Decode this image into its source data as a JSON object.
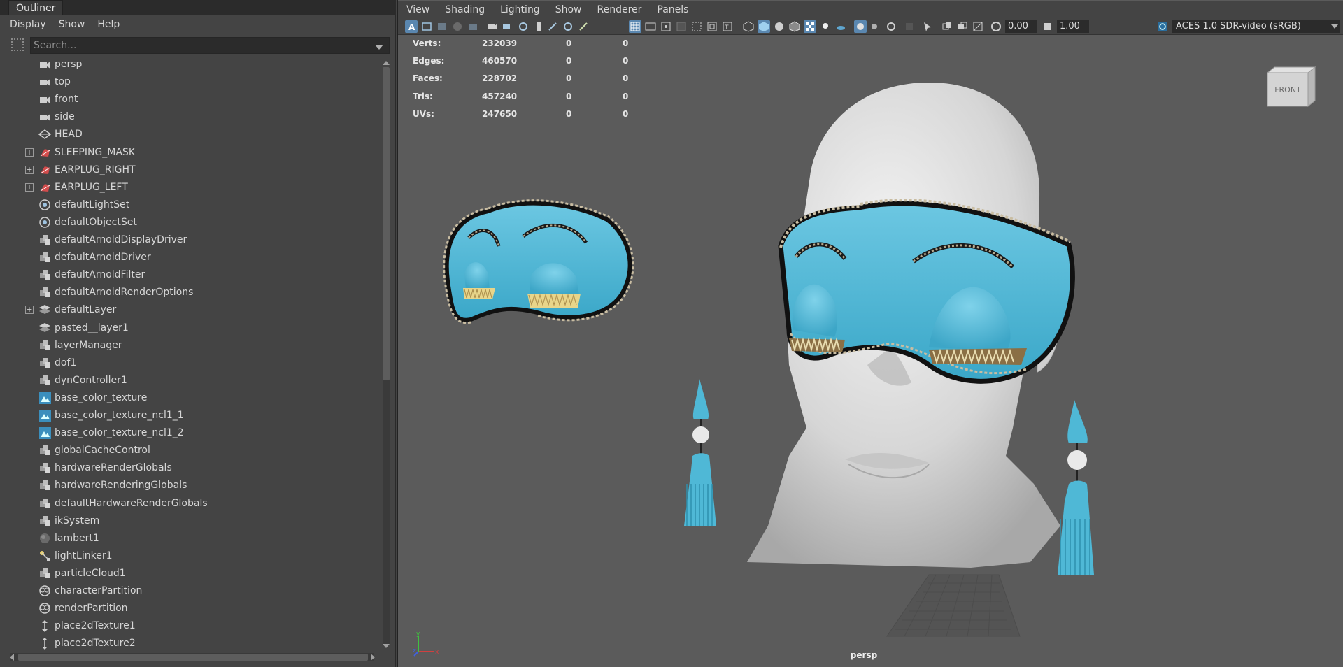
{
  "outliner": {
    "tab": "Outliner",
    "menu": [
      "Display",
      "Show",
      "Help"
    ],
    "search_placeholder": "Search...",
    "items": [
      {
        "label": "persp",
        "icon": "camera-icon",
        "expandable": false
      },
      {
        "label": "top",
        "icon": "camera-icon",
        "expandable": false
      },
      {
        "label": "front",
        "icon": "camera-icon",
        "expandable": false
      },
      {
        "label": "side",
        "icon": "camera-icon",
        "expandable": false
      },
      {
        "label": "HEAD",
        "icon": "mesh-icon",
        "expandable": false
      },
      {
        "label": "SLEEPING_MASK",
        "icon": "mesh-group-icon",
        "expandable": true
      },
      {
        "label": "EARPLUG_RIGHT",
        "icon": "mesh-group-icon",
        "expandable": true
      },
      {
        "label": "EARPLUG_LEFT",
        "icon": "mesh-group-icon",
        "expandable": true
      },
      {
        "label": "defaultLightSet",
        "icon": "set-icon",
        "expandable": false
      },
      {
        "label": "defaultObjectSet",
        "icon": "set-icon",
        "expandable": false
      },
      {
        "label": "defaultArnoldDisplayDriver",
        "icon": "node-icon",
        "expandable": false
      },
      {
        "label": "defaultArnoldDriver",
        "icon": "node-icon",
        "expandable": false
      },
      {
        "label": "defaultArnoldFilter",
        "icon": "node-icon",
        "expandable": false
      },
      {
        "label": "defaultArnoldRenderOptions",
        "icon": "node-icon",
        "expandable": false
      },
      {
        "label": "defaultLayer",
        "icon": "layer-icon",
        "expandable": true
      },
      {
        "label": "pasted__layer1",
        "icon": "layer-icon",
        "expandable": false
      },
      {
        "label": "layerManager",
        "icon": "node-icon",
        "expandable": false
      },
      {
        "label": "dof1",
        "icon": "node-icon",
        "expandable": false
      },
      {
        "label": "dynController1",
        "icon": "node-icon",
        "expandable": false
      },
      {
        "label": "base_color_texture",
        "icon": "texture-icon",
        "expandable": false
      },
      {
        "label": "base_color_texture_ncl1_1",
        "icon": "texture-icon",
        "expandable": false
      },
      {
        "label": "base_color_texture_ncl1_2",
        "icon": "texture-icon",
        "expandable": false
      },
      {
        "label": "globalCacheControl",
        "icon": "node-icon",
        "expandable": false
      },
      {
        "label": "hardwareRenderGlobals",
        "icon": "node-icon",
        "expandable": false
      },
      {
        "label": "hardwareRenderingGlobals",
        "icon": "node-icon",
        "expandable": false
      },
      {
        "label": "defaultHardwareRenderGlobals",
        "icon": "node-icon",
        "expandable": false
      },
      {
        "label": "ikSystem",
        "icon": "node-icon",
        "expandable": false
      },
      {
        "label": "lambert1",
        "icon": "material-sphere-icon",
        "expandable": false
      },
      {
        "label": "lightLinker1",
        "icon": "light-linker-icon",
        "expandable": false
      },
      {
        "label": "particleCloud1",
        "icon": "node-icon",
        "expandable": false
      },
      {
        "label": "characterPartition",
        "icon": "partition-icon",
        "expandable": false
      },
      {
        "label": "renderPartition",
        "icon": "partition-icon",
        "expandable": false
      },
      {
        "label": "place2dTexture1",
        "icon": "place2d-icon",
        "expandable": false
      },
      {
        "label": "place2dTexture2",
        "icon": "place2d-icon",
        "expandable": false
      }
    ]
  },
  "viewport": {
    "menu": [
      "View",
      "Shading",
      "Lighting",
      "Show",
      "Renderer",
      "Panels"
    ],
    "exposure": "0.00",
    "gamma": "1.00",
    "color_space": "ACES 1.0 SDR-video (sRGB)",
    "camera": "persp",
    "view_cube_label": "FRONT",
    "stats": [
      {
        "label": "Verts:",
        "value": "232039",
        "sel": "0",
        "comp": "0"
      },
      {
        "label": "Edges:",
        "value": "460570",
        "sel": "0",
        "comp": "0"
      },
      {
        "label": "Faces:",
        "value": "228702",
        "sel": "0",
        "comp": "0"
      },
      {
        "label": "Tris:",
        "value": "457240",
        "sel": "0",
        "comp": "0"
      },
      {
        "label": "UVs:",
        "value": "247650",
        "sel": "0",
        "comp": "0"
      }
    ]
  },
  "colors": {
    "accent": "#5a87b0",
    "mask": "#4fb8d6",
    "head": "#d9d9d9",
    "lashes": "#e8d58a"
  }
}
